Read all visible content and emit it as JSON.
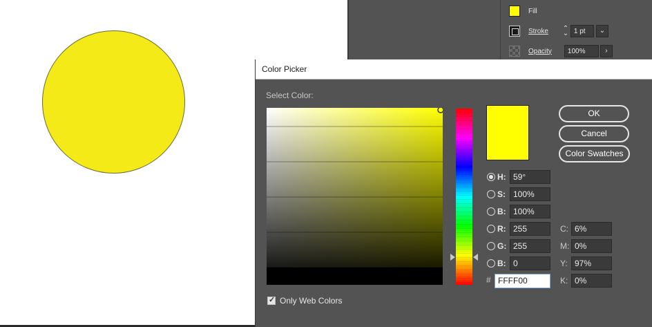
{
  "properties_panel": {
    "fill_label": "Fill",
    "stroke_label": "Stroke",
    "stroke_weight": "1 pt",
    "opacity_label": "Opacity",
    "opacity_value": "100%",
    "fill_color": "#ffff00"
  },
  "canvas": {
    "circle_fill": "#f4ea18"
  },
  "color_picker": {
    "title": "Color Picker",
    "select_color_label": "Select Color:",
    "buttons": {
      "ok": "OK",
      "cancel": "Cancel",
      "color_swatches": "Color Swatches"
    },
    "hsb": [
      {
        "key": "H",
        "label": "H:",
        "value": "59°",
        "selected": true
      },
      {
        "key": "S",
        "label": "S:",
        "value": "100%",
        "selected": false
      },
      {
        "key": "B",
        "label": "B:",
        "value": "100%",
        "selected": false
      }
    ],
    "rgb": [
      {
        "key": "R",
        "label": "R:",
        "value": "255"
      },
      {
        "key": "G",
        "label": "G:",
        "value": "255"
      },
      {
        "key": "B",
        "label": "B:",
        "value": "0"
      }
    ],
    "cmyk": [
      {
        "key": "C",
        "label": "C:",
        "value": "6%"
      },
      {
        "key": "M",
        "label": "M:",
        "value": "0%"
      },
      {
        "key": "Y",
        "label": "Y:",
        "value": "97%"
      },
      {
        "key": "K",
        "label": "K:",
        "value": "0%"
      }
    ],
    "hex_symbol": "#",
    "hex_value": "FFFF00",
    "only_web_colors_label": "Only Web Colors",
    "only_web_colors_checked": true,
    "preview_color": "#ffff00"
  }
}
